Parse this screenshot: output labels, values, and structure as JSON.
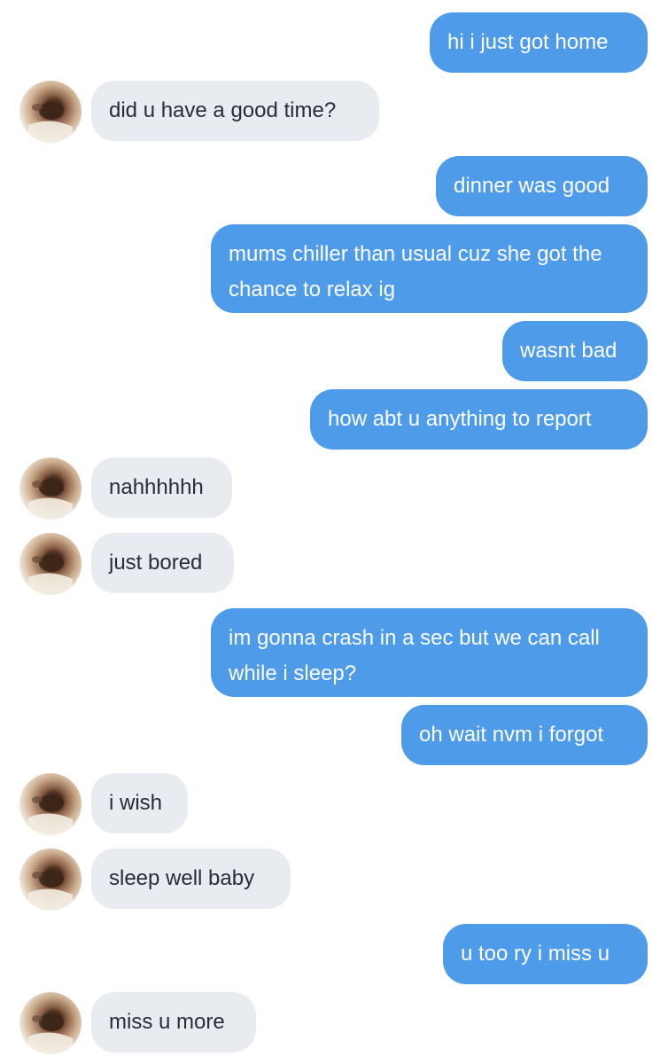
{
  "conversation": {
    "messages": [
      {
        "sender": "me",
        "text": "hi i just got home"
      },
      {
        "sender": "them",
        "text": "did u have a good time?"
      },
      {
        "sender": "me",
        "text": "dinner was good"
      },
      {
        "sender": "me",
        "text": "mums chiller than usual cuz she got the chance to relax ig"
      },
      {
        "sender": "me",
        "text": "wasnt bad"
      },
      {
        "sender": "me",
        "text": "how abt u anything to report"
      },
      {
        "sender": "them",
        "text": "nahhhhhh"
      },
      {
        "sender": "them",
        "text": "just bored"
      },
      {
        "sender": "me",
        "text": "im gonna crash in a sec but we can call while i sleep?"
      },
      {
        "sender": "me",
        "text": "oh wait nvm i forgot"
      },
      {
        "sender": "them",
        "text": "i wish"
      },
      {
        "sender": "them",
        "text": "sleep well baby"
      },
      {
        "sender": "me",
        "text": "u too ry i miss u"
      },
      {
        "sender": "them",
        "text": "miss u more"
      }
    ]
  },
  "theme": {
    "outgoing_bubble": "#4d9be9",
    "incoming_bubble": "#e8ebf0"
  },
  "icons": {
    "avatar": "contact-avatar-photo"
  }
}
